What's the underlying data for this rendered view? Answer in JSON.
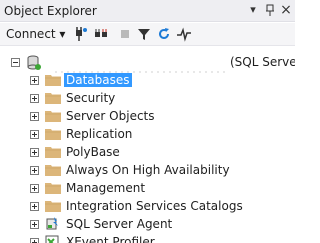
{
  "panel": {
    "title": "Object Explorer",
    "pin_glyph": "▾",
    "pushpin_glyph": "ᛘ",
    "close_glyph": "×"
  },
  "toolbar": {
    "connect_label": "Connect ▾",
    "icons": [
      "connect-icon",
      "disconnect-icon",
      "stop-icon",
      "filter-icon",
      "refresh-icon",
      "activity-monitor-icon"
    ]
  },
  "tree": {
    "server_label": "(SQL Server",
    "items": [
      {
        "label": "Databases",
        "icon": "folder-icon",
        "selected": true
      },
      {
        "label": "Security",
        "icon": "folder-icon"
      },
      {
        "label": "Server Objects",
        "icon": "folder-icon"
      },
      {
        "label": "Replication",
        "icon": "folder-icon"
      },
      {
        "label": "PolyBase",
        "icon": "folder-icon"
      },
      {
        "label": "Always On High Availability",
        "icon": "folder-icon"
      },
      {
        "label": "Management",
        "icon": "folder-icon"
      },
      {
        "label": "Integration Services Catalogs",
        "icon": "folder-icon"
      },
      {
        "label": "SQL Server Agent",
        "icon": "sql-agent-icon"
      },
      {
        "label": "XEvent Profiler",
        "icon": "xevent-profiler-icon"
      }
    ]
  },
  "colors": {
    "selection": "#3399ff",
    "folder": "#dcb67a",
    "accent": "#1e7bd6"
  }
}
